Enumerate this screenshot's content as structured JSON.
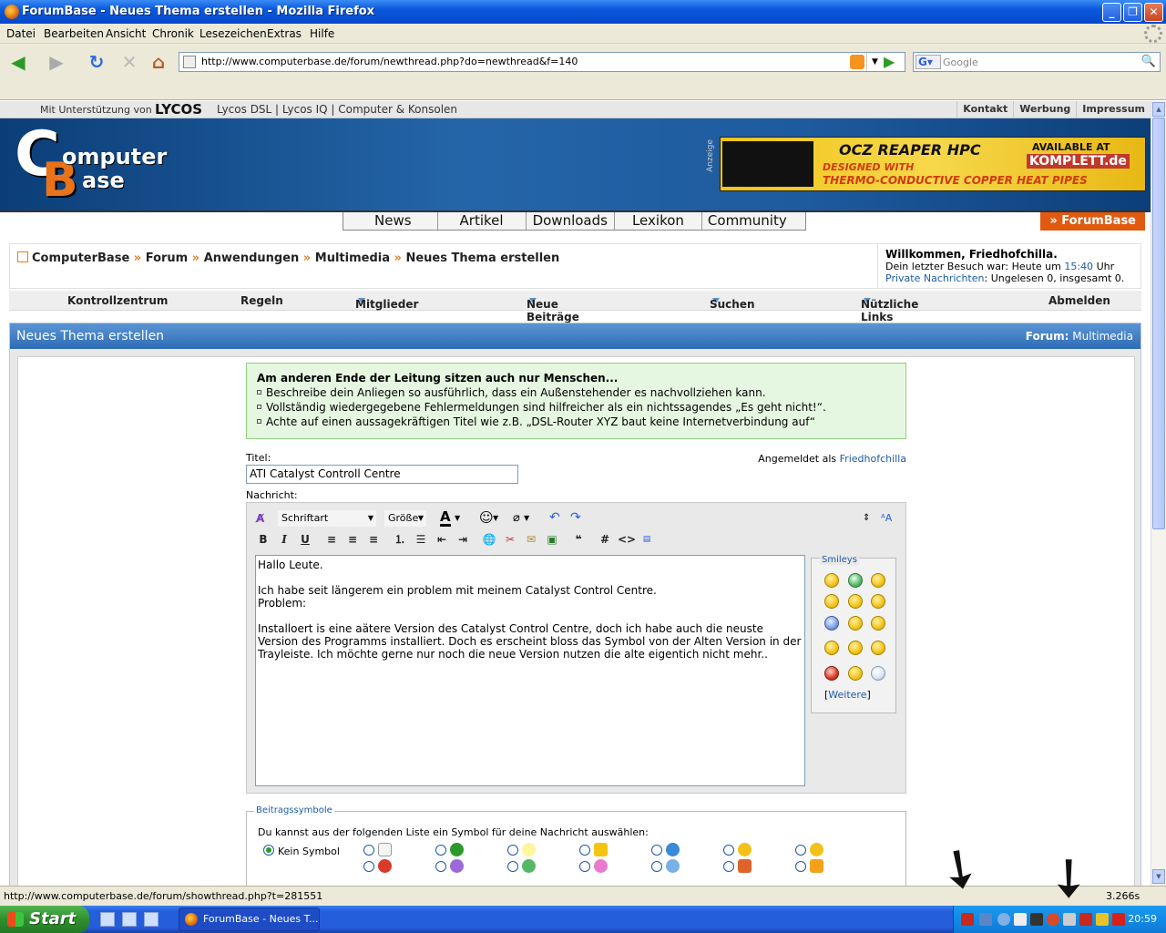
{
  "window": {
    "title": "ForumBase - Neues Thema erstellen - Mozilla Firefox"
  },
  "menu": [
    "Datei",
    "Bearbeiten",
    "Ansicht",
    "Chronik",
    "Lesezeichen",
    "Extras",
    "Hilfe"
  ],
  "nav": {
    "url": "http://www.computerbase.de/forum/newthread.php?do=newthread&f=140",
    "search_placeholder": "Google"
  },
  "top_strip": {
    "support": "Mit Unterstützung von",
    "lycos": "LYCOS",
    "links": "Lycos DSL | Lycos IQ | Computer & Konsolen",
    "right_links": [
      "Kontakt",
      "Werbung",
      "Impressum"
    ]
  },
  "logo": {
    "t1": "omputer",
    "t2": "ase"
  },
  "ad": {
    "label": "Anzeige",
    "brand": "OCZ REAPER HPC",
    "line1": "DESIGNED WITH",
    "line2": "THERMO-CONDUCTIVE COPPER HEAT PIPES",
    "avail": "AVAILABLE AT",
    "shop": "KOMPLETT.de"
  },
  "main_nav": {
    "tabs": [
      "News",
      "Artikel",
      "Downloads",
      "Lexikon",
      "Community"
    ],
    "forumbase": "» ForumBase"
  },
  "breadcrumb": {
    "items": [
      "ComputerBase",
      "Forum",
      "Anwendungen",
      "Multimedia",
      "Neues Thema erstellen"
    ],
    "sep": "»"
  },
  "welcome": {
    "greeting": "Willkommen, Friedhofchilla.",
    "last_visit_prefix": "Dein letzter Besuch war: Heute um",
    "last_visit_time": "15:40",
    "last_visit_suffix": "Uhr",
    "pm_link": "Private Nachrichten",
    "pm_text": ": Ungelesen 0, insgesamt 0."
  },
  "sub_nav": [
    "Kontrollzentrum",
    "Regeln",
    "Mitglieder",
    "Neue Beiträge",
    "Suchen",
    "Nützliche Links",
    "Abmelden"
  ],
  "panel": {
    "title": "Neues Thema erstellen",
    "forum_label": "Forum:",
    "forum_name": "Multimedia"
  },
  "tips": {
    "heading": "Am anderen Ende der Leitung sitzen auch nur Menschen...",
    "items": [
      "Beschreibe dein Anliegen so ausführlich, dass ein Außenstehender es nachvollziehen kann.",
      "Vollständig wiedergegebene Fehlermeldungen sind hilfreicher als ein nichtssagendes „Es geht nicht!“.",
      "Achte auf einen aussagekräftigen Titel wie z.B. „DSL-Router XYZ baut keine Internetverbindung auf“"
    ]
  },
  "form": {
    "title_label": "Titel:",
    "title_value": "ATI Catalyst Controll Centre",
    "logged_in": "Angemeldet als",
    "user": "Friedhofchilla",
    "message_label": "Nachricht:"
  },
  "editor": {
    "font": "Schriftart",
    "size": "Größe",
    "message": "Hallo Leute.\n\nIch habe seit längerem ein problem mit meinem Catalyst Control Centre.\nProblem:\n\nInstalloert is eine aätere Version des Catalyst Control Centre, doch ich habe auch die neuste Version des Programms installiert. Doch es erscheint bloss das Symbol von der Alten Version in der Trayleiste. Ich möchte gerne nur noch die neue Version nutzen die alte eigentich nicht mehr..",
    "smileys_label": "Smileys",
    "smileys_more": "Weitere"
  },
  "symbols": {
    "legend": "Beitragssymbole",
    "desc": "Du kannst aus der folgenden Liste ein Symbol für deine Nachricht auswählen:",
    "none": "Kein Symbol"
  },
  "status": {
    "url": "http://www.computerbase.de/forum/showthread.php?t=281551",
    "time": "3.266s"
  },
  "taskbar": {
    "start": "Start",
    "task": "ForumBase - Neues T...",
    "clock": "20:59"
  }
}
